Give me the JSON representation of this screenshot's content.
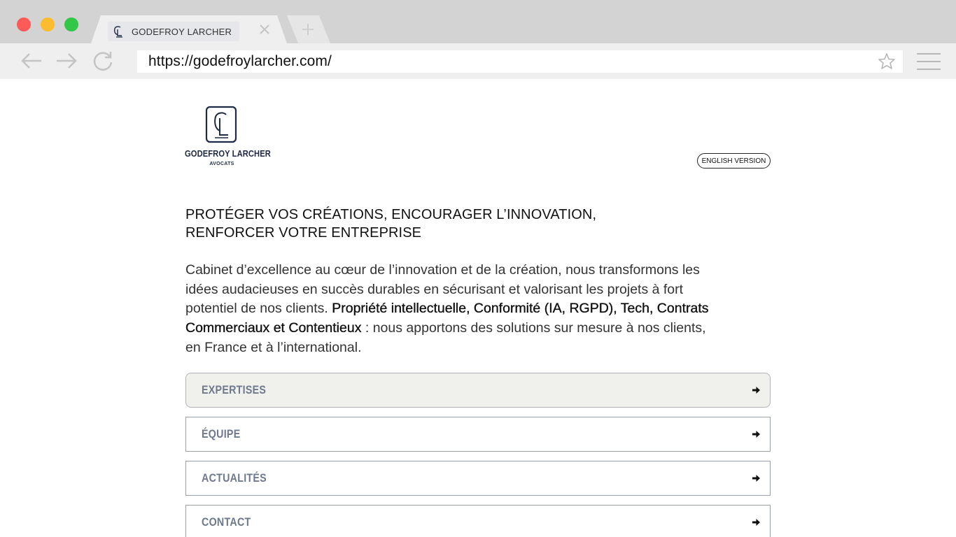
{
  "browser": {
    "tab_title": "GODEFROY LARCHER",
    "url": "https://godefroylarcher.com/"
  },
  "header": {
    "logo_name": "GODEFROY LARCHER",
    "logo_subtitle": "AVOCATS",
    "language_button": "ENGLISH VERSION"
  },
  "main": {
    "headline": "PROTÉGER VOS CRÉATIONS, ENCOURAGER L’INNOVATION, RENFORCER VOTRE ENTREPRISE",
    "intro_part1": "Cabinet d’excellence au cœur de l’innovation et de la création, nous transformons les idées audacieuses en succès durables en sécurisant et valorisant les projets à fort potentiel de nos clients. ",
    "intro_bold": "Propriété intellectuelle, Conformité (IA, RGPD), Tech, Contrats Commerciaux et Contentieux",
    "intro_part2": " : nous apportons des solutions sur mesure à nos clients, en France et à l’international.",
    "menu": [
      {
        "label": "EXPERTISES"
      },
      {
        "label": "ÉQUIPE"
      },
      {
        "label": "ACTUALITÉS"
      },
      {
        "label": "CONTACT"
      }
    ]
  },
  "colors": {
    "brand_navy": "#1f2a44",
    "menu_label": "#6e7a8c",
    "active_item_bg": "#f0f0ec"
  },
  "icons": [
    "gl-monogram-icon",
    "close-icon",
    "plus-icon",
    "back-arrow-icon",
    "forward-arrow-icon",
    "reload-icon",
    "star-icon",
    "hamburger-menu-icon",
    "arrow-right-icon"
  ]
}
